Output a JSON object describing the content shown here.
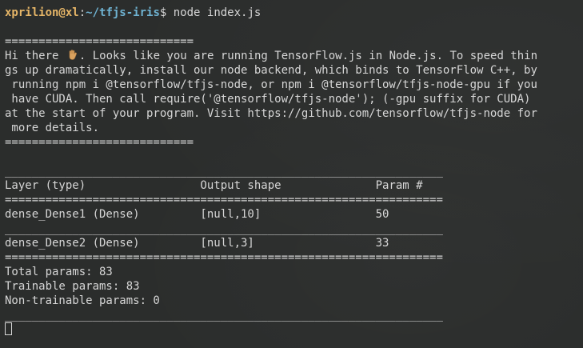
{
  "prompt": {
    "user_host": "xprilion@xl",
    "separator": ":",
    "path": "~/tfjs-iris",
    "symbol": "$",
    "command": " node index.js"
  },
  "notice": {
    "rule": "============================",
    "line1_a": "Hi there ",
    "wave_icon": "waving-hand",
    "line1_b": ". Looks like you are running TensorFlow.js in Node.js. To speed thin",
    "line2": "gs up dramatically, install our node backend, which binds to TensorFlow C++, by",
    "line3": " running npm i @tensorflow/tfjs-node, or npm i @tensorflow/tfjs-node-gpu if you",
    "line4": " have CUDA. Then call require('@tensorflow/tfjs-node'); (-gpu suffix for CUDA)",
    "line5": "at the start of your program. Visit https://github.com/tensorflow/tfjs-node for",
    "line6": " more details."
  },
  "summary": {
    "rule_dash": "_________________________________________________________________",
    "rule_double": "=================================================================",
    "header": "Layer (type)                 Output shape              Param #",
    "rows": [
      "dense_Dense1 (Dense)         [null,10]                 50",
      "dense_Dense2 (Dense)         [null,3]                  33"
    ],
    "total": "Total params: 83",
    "trainable": "Trainable params: 83",
    "non_trainable": "Non-trainable params: 0"
  },
  "colors": {
    "background": "#2b2d2c",
    "text": "#d6d6d6",
    "user_host": "#e5b567",
    "path": "#6fb3d2"
  }
}
